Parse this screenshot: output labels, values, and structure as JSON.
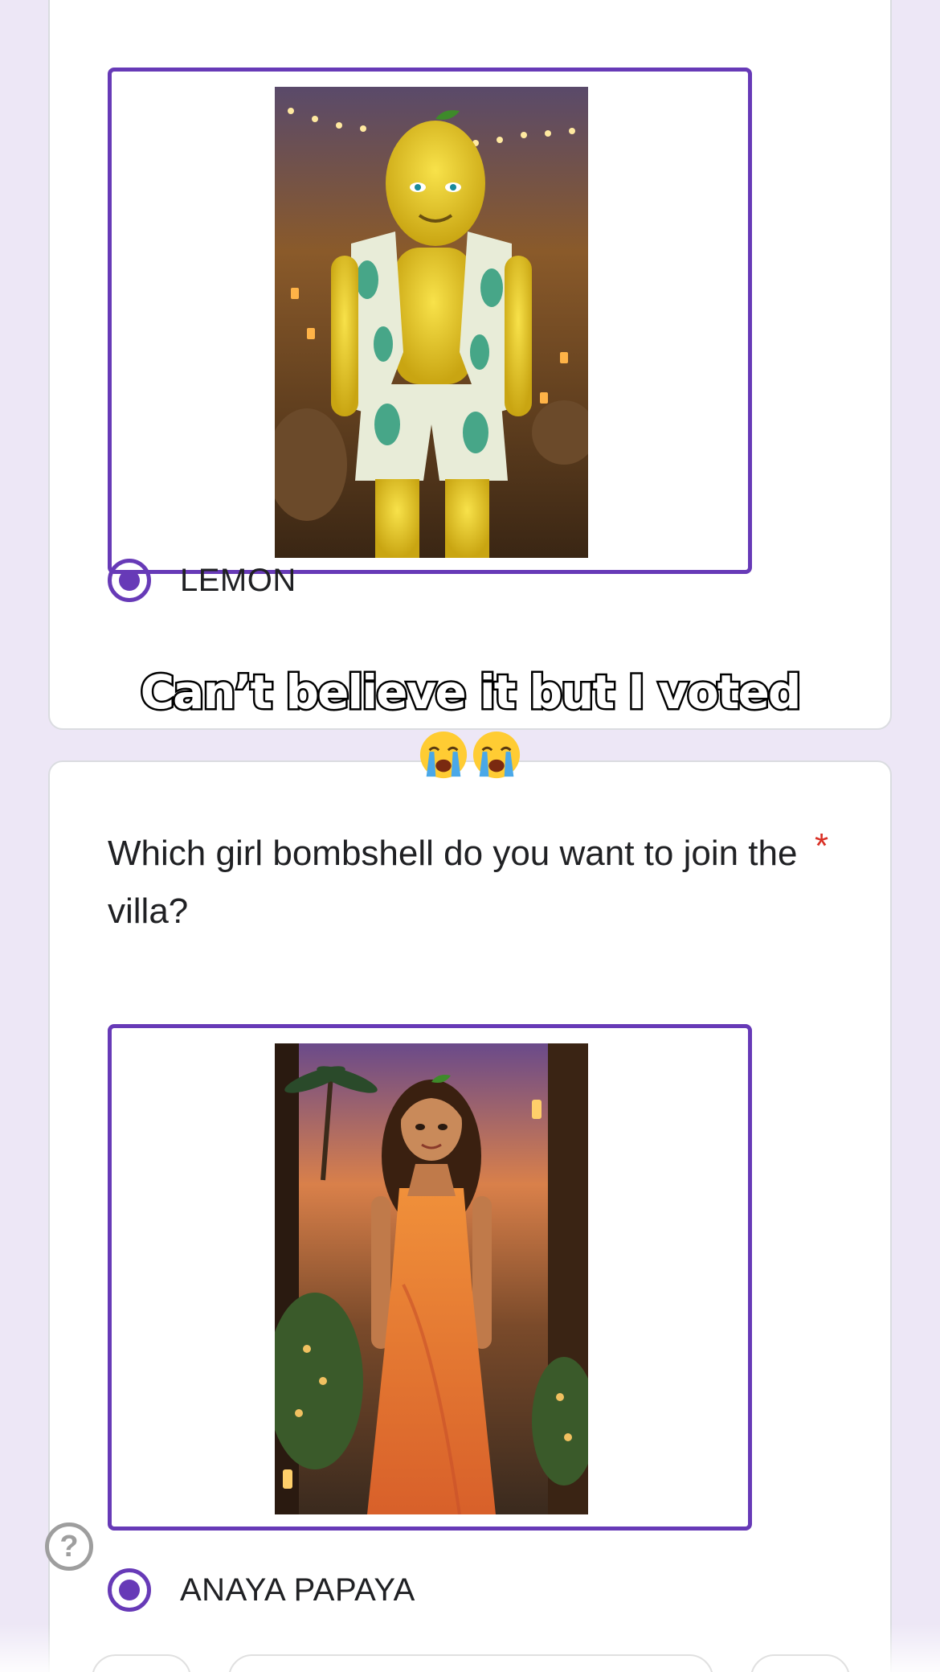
{
  "card1": {
    "option": {
      "label": "LEMON",
      "image_icon": "lemon-character-image"
    }
  },
  "overlay": {
    "caption": "Can’t believe it but I voted",
    "emoji": "😭😭"
  },
  "card2": {
    "question": "Which girl bombshell do you want to join the villa?",
    "required_mark": "*",
    "option": {
      "label": "ANAYA PAPAYA",
      "image_icon": "papaya-character-image"
    }
  },
  "help": {
    "label": "?",
    "icon": "help-icon"
  },
  "colors": {
    "accent": "#673ab7",
    "background": "#ede7f6",
    "required": "#d93025"
  }
}
